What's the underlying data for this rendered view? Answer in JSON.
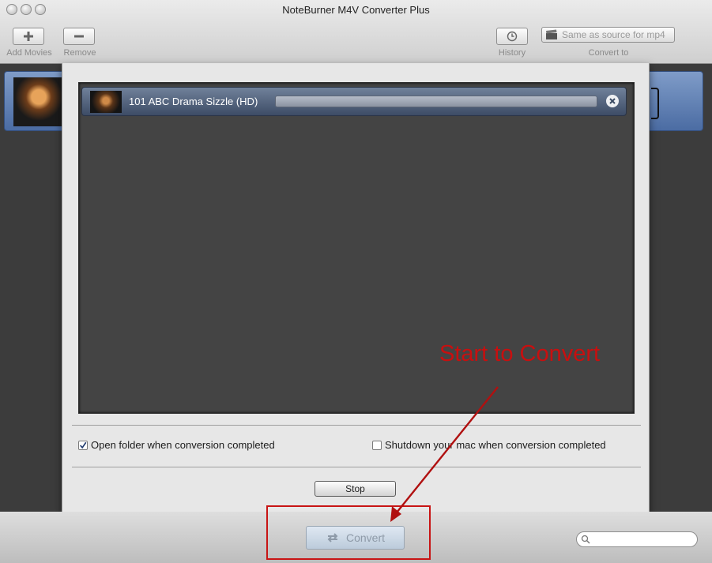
{
  "window": {
    "title": "NoteBurner M4V Converter Plus"
  },
  "toolbar": {
    "add_label": "Add Movies",
    "remove_label": "Remove",
    "history_label": "History",
    "convert_to_label": "Convert to",
    "format_value": "Same as source for mp4"
  },
  "task": {
    "title": "101 ABC Drama Sizzle (HD)",
    "progress": 0
  },
  "options": {
    "open_folder_label": "Open folder when conversion completed",
    "open_folder_checked": true,
    "shutdown_label": "Shutdown your mac when conversion completed",
    "shutdown_checked": false
  },
  "dialog": {
    "stop_label": "Stop"
  },
  "bottom": {
    "convert_label": "Convert",
    "search_placeholder": ""
  },
  "annotation": {
    "text": "Start to Convert",
    "color": "#c80f0f"
  }
}
